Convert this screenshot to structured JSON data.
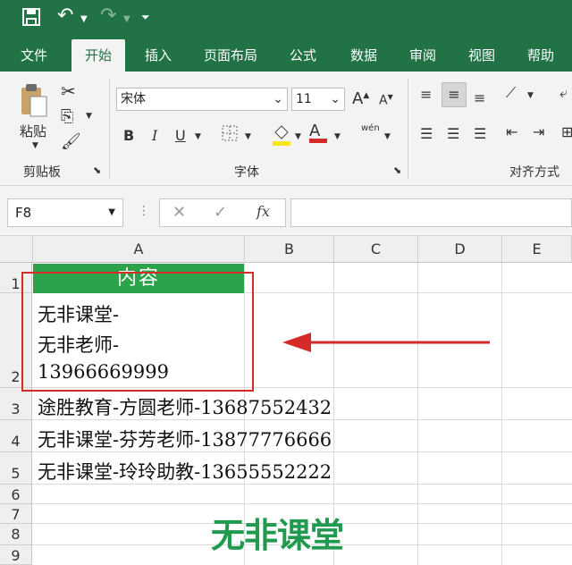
{
  "tabs": [
    "文件",
    "开始",
    "插入",
    "页面布局",
    "公式",
    "数据",
    "审阅",
    "视图",
    "帮助"
  ],
  "active_tab": "开始",
  "ribbon": {
    "paste_label": "粘贴",
    "clipboard_group": "剪贴板",
    "font_name": "宋体",
    "font_size": "11",
    "font_group": "字体",
    "bold": "B",
    "italic": "I",
    "underline": "U",
    "align_group": "对齐方式",
    "font_color_glyph": "A",
    "phonetic_glyph": "wén"
  },
  "formula_bar": {
    "name_box": "F8",
    "fx": "fx",
    "content": ""
  },
  "columns": [
    "A",
    "B",
    "C",
    "D",
    "E"
  ],
  "rows": [
    "1",
    "2",
    "3",
    "4",
    "5",
    "6",
    "7",
    "8",
    "9"
  ],
  "cells": {
    "A1": "内容",
    "A2_lines": [
      "无非课堂-",
      "无非老师-",
      "13966669999"
    ],
    "A3": "途胜教育-方圆老师-13687552432",
    "A4": "无非课堂-芬芳老师-13877776666",
    "A5": "无非课堂-玲玲助教-13655552222"
  },
  "watermark": "无非课堂",
  "colors": {
    "excel_green": "#217346",
    "header_fill": "#2aa34a",
    "highlight_red": "#d42a2a",
    "watermark_green": "#1f9a4e"
  }
}
